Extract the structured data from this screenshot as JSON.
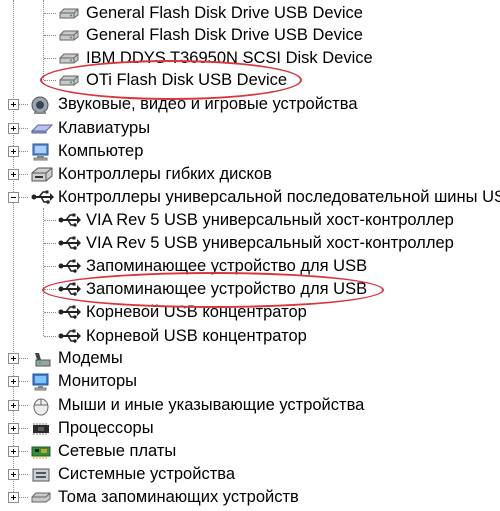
{
  "tree": {
    "disk_drives": [
      {
        "label": "General Flash Disk Drive USB Device",
        "icon": "disk-drive-icon"
      },
      {
        "label": "General Flash Disk Drive USB Device",
        "icon": "disk-drive-icon"
      },
      {
        "label": "IBM DDYS T36950N SCSI Disk Device",
        "icon": "disk-drive-icon"
      },
      {
        "label": "OTi Flash Disk USB Device",
        "icon": "disk-drive-icon",
        "highlighted": true
      }
    ],
    "categories_top": [
      {
        "label": "Звуковые, видео и игровые устройства",
        "icon": "speaker-icon"
      },
      {
        "label": "Клавиатуры",
        "icon": "keyboard-icon"
      },
      {
        "label": "Компьютер",
        "icon": "computer-icon"
      },
      {
        "label": "Контроллеры гибких дисков",
        "icon": "floppy-controller-icon"
      }
    ],
    "usb_category": {
      "label": "Контроллеры универсальной последовательной шины USB",
      "icon": "usb-icon",
      "expanded": true,
      "children": [
        {
          "label": "VIA Rev 5 USB универсальный хост-контроллер",
          "icon": "usb-icon"
        },
        {
          "label": "VIA Rev 5 USB универсальный хост-контроллер",
          "icon": "usb-icon"
        },
        {
          "label": "Запоминающее устройство для USB",
          "icon": "usb-icon"
        },
        {
          "label": "Запоминающее устройство для USB",
          "icon": "usb-icon",
          "highlighted": true
        },
        {
          "label": "Корневой USB концентратор",
          "icon": "usb-icon"
        },
        {
          "label": "Корневой USB концентратор",
          "icon": "usb-icon"
        }
      ]
    },
    "categories_bottom": [
      {
        "label": "Модемы",
        "icon": "modem-icon"
      },
      {
        "label": "Мониторы",
        "icon": "monitor-icon"
      },
      {
        "label": "Мыши и иные указывающие устройства",
        "icon": "mouse-icon"
      },
      {
        "label": "Процессоры",
        "icon": "processor-icon"
      },
      {
        "label": "Сетевые платы",
        "icon": "network-card-icon"
      },
      {
        "label": "Системные устройства",
        "icon": "system-devices-icon"
      },
      {
        "label": "Тома запоминающих устройств",
        "icon": "storage-volumes-icon"
      }
    ]
  },
  "colors": {
    "highlight_ring": "#d9363e",
    "tree_lines": "#8a8a8a"
  }
}
